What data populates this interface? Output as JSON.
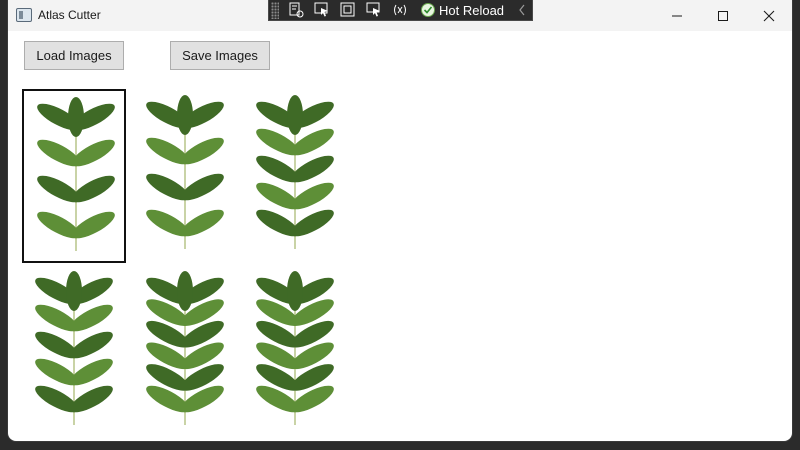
{
  "window": {
    "title": "Atlas Cutter",
    "app_icon": "window-app-icon",
    "caption_buttons": [
      "minimize-icon",
      "maximize-icon",
      "close-icon"
    ]
  },
  "debug_toolbar": {
    "hot_reload_label": "Hot Reload",
    "icons": [
      "live-visual-tree-icon",
      "select-element-icon",
      "display-layout-adorners-icon",
      "track-focus-icon",
      "binding-failures-icon",
      "hot-reload-check-icon",
      "collapse-chevron-icon"
    ]
  },
  "toolbar": {
    "load_label": "Load Images",
    "save_label": "Save Images"
  },
  "gallery": {
    "items": [
      {
        "icon": "leaf-sprite",
        "selected": true
      },
      {
        "icon": "leaf-sprite",
        "selected": false
      },
      {
        "icon": "leaf-sprite",
        "selected": false
      },
      {
        "icon": "leaf-sprite",
        "selected": false
      },
      {
        "icon": "leaf-sprite",
        "selected": false
      },
      {
        "icon": "leaf-sprite",
        "selected": false
      }
    ]
  },
  "colors": {
    "leaf_dark": "#3f6a26",
    "leaf_light": "#5e8f37",
    "stem": "#c9d3a6",
    "selection_border": "#111111",
    "button_bg": "#e1e1e1"
  }
}
